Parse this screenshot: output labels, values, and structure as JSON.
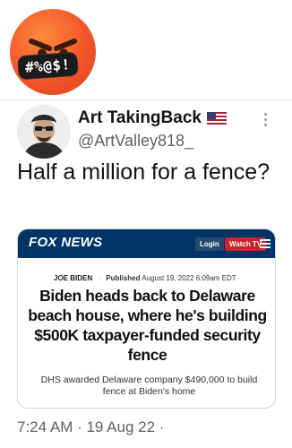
{
  "sticker": {
    "emoji_icon": "angry-face-emoji",
    "symbols": "#%@$!"
  },
  "tweet": {
    "author_name": "Art TakingBack",
    "handle": "@ArtValley818_",
    "flag_icon": "us-flag-icon",
    "text": "Half a million for a fence?",
    "timestamp": "7:24 AM · 19 Aug 22 ·"
  },
  "article_card": {
    "site_logo": "FOX NEWS",
    "login_label": "Login",
    "watch_label": "Watch TV",
    "menu_icon": "hamburger-menu-icon",
    "author": "JOE BIDEN",
    "published_label": "Published",
    "published_date": "August 19, 2022 6:09am EDT",
    "headline": "Biden heads back to Delaware beach house, where he's building $500K taxpayer-funded security fence",
    "subhead": "DHS awarded Delaware company $490,000 to build fence at Biden's home"
  },
  "colors": {
    "fox_navy": "#003366",
    "watch_red": "#c9242b",
    "emoji_orange": "#f2552a",
    "secondary_text": "#536471"
  }
}
